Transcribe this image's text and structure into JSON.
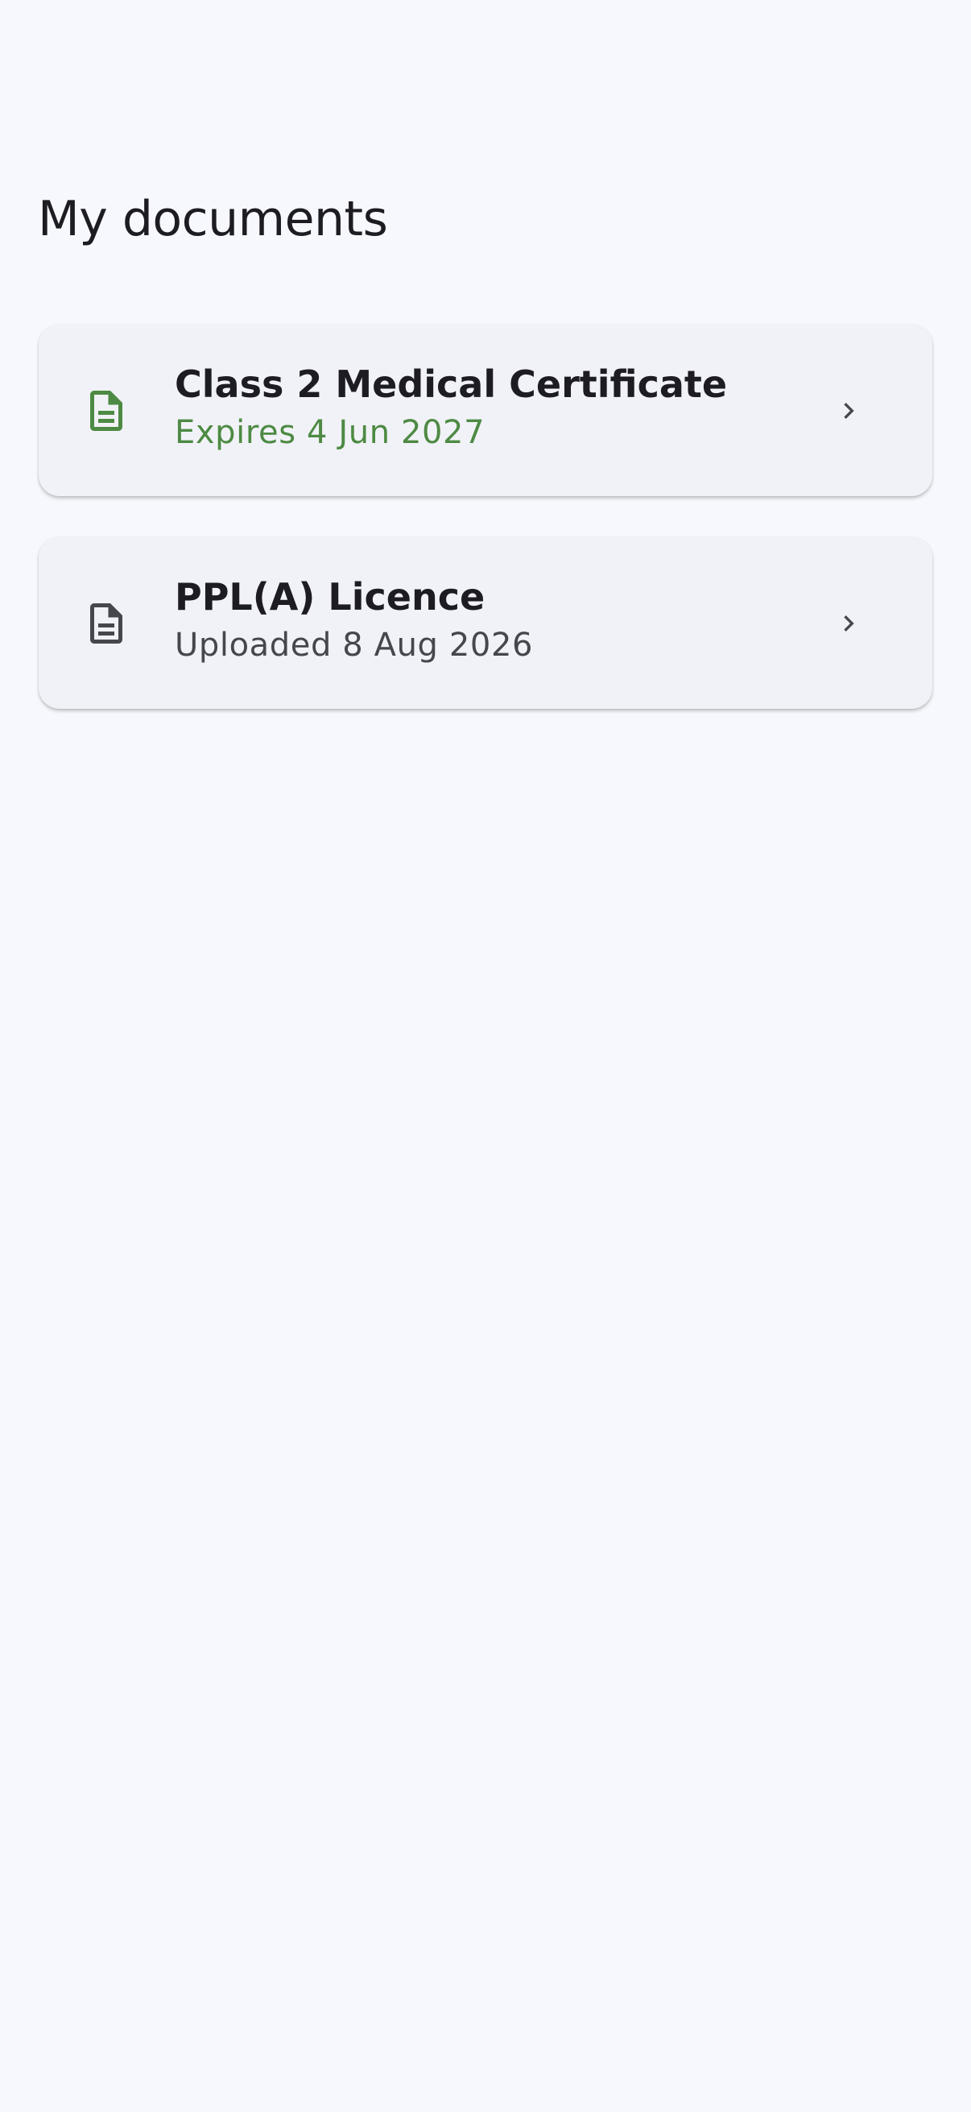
{
  "page": {
    "title": "My documents"
  },
  "documents": [
    {
      "icon": "document-icon",
      "title": "Class 2 Medical Certificate",
      "subtitle": "Expires 4 Jun 2027",
      "accent_color": "#4d8a43"
    },
    {
      "icon": "document-icon",
      "title": "PPL(A) Licence",
      "subtitle": "Uploaded 8 Aug 2026",
      "accent_color": "#45474d"
    }
  ],
  "colors": {
    "background": "#f7f8fd",
    "card": "#f1f2f7",
    "text_primary": "#1c1c22",
    "chevron": "#45474d"
  }
}
